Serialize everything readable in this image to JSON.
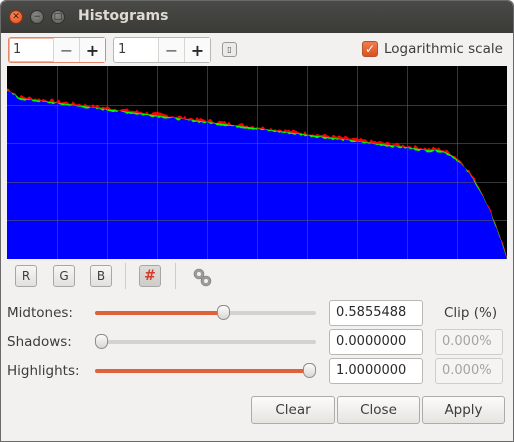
{
  "window": {
    "title": "Histograms"
  },
  "toolbar": {
    "spin1_value": "1",
    "spin2_value": "1",
    "minus": "−",
    "plus": "+",
    "log_scale_label": "Logarithmic scale",
    "log_scale_checked": true
  },
  "channels": {
    "r": "R",
    "g": "G",
    "b": "B",
    "grid_toggle": "grid-icon",
    "settings": "gear-icon"
  },
  "histogram": {
    "background": "#000000",
    "colors": {
      "red": "#ff0000",
      "green": "#00ff00",
      "blue": "#0000ff",
      "grid": "#5a5a5a"
    }
  },
  "sliders": {
    "midtones": {
      "label": "Midtones:",
      "value": "0.5855488",
      "level": 0.5855488
    },
    "shadows": {
      "label": "Shadows:",
      "value": "0.0000000",
      "level": 0.0
    },
    "highlights": {
      "label": "Highlights:",
      "value": "1.0000000",
      "level": 1.0
    }
  },
  "clip": {
    "header": "Clip (%)",
    "shadows": "0.000%",
    "highlights": "0.000%"
  },
  "buttons": {
    "clear": "Clear",
    "close": "Close",
    "apply": "Apply"
  }
}
